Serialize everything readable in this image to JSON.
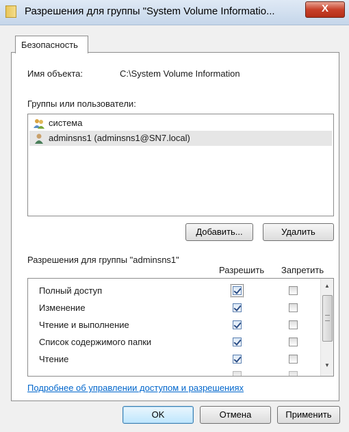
{
  "window": {
    "title": "Разрешения для группы \"System Volume Informatio...",
    "close_glyph": "X"
  },
  "tab": {
    "label": "Безопасность"
  },
  "object": {
    "label": "Имя объекта:",
    "value": "C:\\System Volume Information"
  },
  "groups": {
    "label": "Группы или пользователи:",
    "items": [
      {
        "name": "система",
        "icon": "users-group-icon",
        "selected": false
      },
      {
        "name": "adminsns1 (adminsns1@SN7.local)",
        "icon": "user-icon",
        "selected": true
      }
    ]
  },
  "buttons": {
    "add": "Добавить...",
    "remove": "Удалить",
    "ok": "OK",
    "cancel": "Отмена",
    "apply": "Применить"
  },
  "permissions": {
    "label": "Разрешения для группы \"adminsns1\"",
    "col_allow": "Разрешить",
    "col_deny": "Запретить",
    "rows": [
      {
        "name": "Полный доступ",
        "allow": true,
        "deny": false
      },
      {
        "name": "Изменение",
        "allow": true,
        "deny": false
      },
      {
        "name": "Чтение и выполнение",
        "allow": true,
        "deny": false
      },
      {
        "name": "Список содержимого папки",
        "allow": true,
        "deny": false
      },
      {
        "name": "Чтение",
        "allow": true,
        "deny": false
      }
    ]
  },
  "help_link": "Подробнее об управлении доступом и разрешениях",
  "colors": {
    "link": "#0066cc",
    "close_button": "#c8412a",
    "selection": "#e6e6e6"
  }
}
